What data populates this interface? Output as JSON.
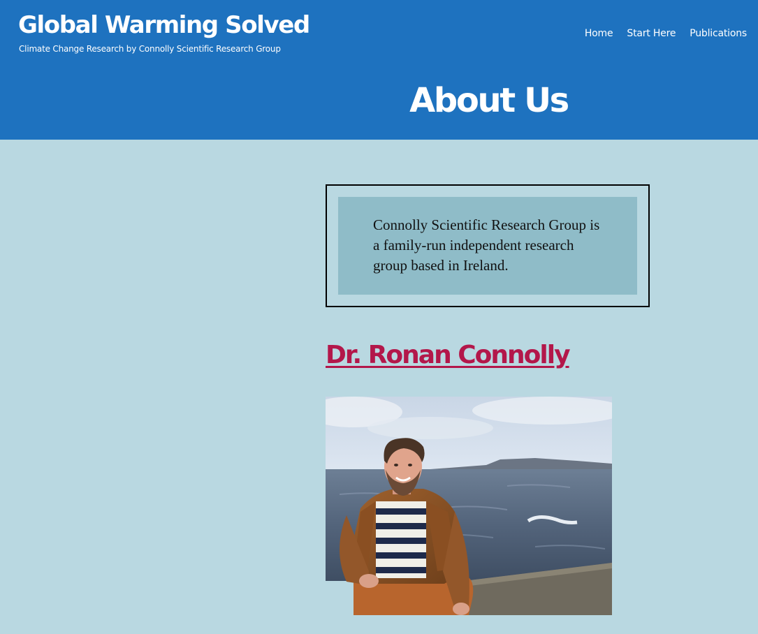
{
  "header": {
    "site_title": "Global Warming Solved",
    "tagline": "Climate Change Research by Connolly Scientific Research Group",
    "nav": [
      {
        "label": "Home"
      },
      {
        "label": "Start Here"
      },
      {
        "label": "Publications"
      }
    ]
  },
  "page": {
    "title": "About Us"
  },
  "intro": {
    "text": "Connolly Scientific Research Group is a family-run independent research group based in Ireland."
  },
  "person": {
    "name": "Dr. Ronan Connolly"
  },
  "colors": {
    "header_bg": "#1e72bf",
    "page_bg": "#b9d8e1",
    "intro_bg": "#8fbcc8",
    "link_color": "#b3174a"
  }
}
